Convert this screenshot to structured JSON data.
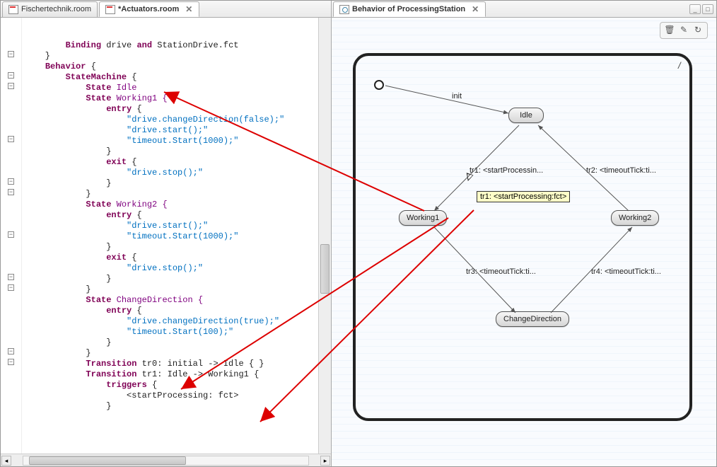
{
  "tabs_left": [
    {
      "label": "Fischertechnik.room",
      "active": false
    },
    {
      "label": "*Actuators.room",
      "active": true
    }
  ],
  "tabs_right": [
    {
      "label": "Behavior of ProcessingStation",
      "active": true
    }
  ],
  "code": {
    "l1_a": "Binding",
    "l1_b": " drive ",
    "l1_c": "and",
    "l1_d": " StationDrive.fct",
    "l2": "    }",
    "l3_a": "Behavior",
    "l3_b": " {",
    "l4_a": "StateMachine",
    "l4_b": " {",
    "l5_a": "State",
    "l5_b": " Idle",
    "l6_a": "State",
    "l6_b": " Working1 {",
    "l7_a": "entry",
    "l7_b": " {",
    "l8": "\"drive.changeDirection(false);\"",
    "l9": "\"drive.start();\"",
    "l10": "\"timeout.Start(1000);\"",
    "l11": "}",
    "l12_a": "exit",
    "l12_b": " {",
    "l13": "\"drive.stop();\"",
    "l14": "}",
    "l15": "}",
    "l16_a": "State",
    "l16_b": " Working2 {",
    "l17_a": "entry",
    "l17_b": " {",
    "l18": "\"drive.start();\"",
    "l19": "\"timeout.Start(1000);\"",
    "l20": "}",
    "l21_a": "exit",
    "l21_b": " {",
    "l22": "\"drive.stop();\"",
    "l23": "}",
    "l24": "}",
    "l25_a": "State",
    "l25_b": " ChangeDirection {",
    "l26_a": "entry",
    "l26_b": " {",
    "l27": "\"drive.changeDirection(true);\"",
    "l28": "\"timeout.Start(100);\"",
    "l29": "}",
    "l30": "}",
    "l31_a": "Transition",
    "l31_b": " tr0: initial -> Idle { }",
    "l32_a": "Transition",
    "l32_b": " tr1: Idle -> Working1 {",
    "l33_a": "triggers",
    "l33_b": " {",
    "l34": "<startProcessing: fct>",
    "l35": "}"
  },
  "diagram": {
    "init_label": "init",
    "states": {
      "idle": "Idle",
      "working1": "Working1",
      "working2": "Working2",
      "changeDirection": "ChangeDirection"
    },
    "transitions": {
      "tr1": "tr1: <startProcessin...",
      "tr2": "tr2: <timeoutTick:ti...",
      "tr3": "tr3: <timeoutTick:ti...",
      "tr4": "tr4: <timeoutTick:ti..."
    },
    "tooltip": "tr1: <startProcessing:fct>",
    "slash": "/"
  }
}
